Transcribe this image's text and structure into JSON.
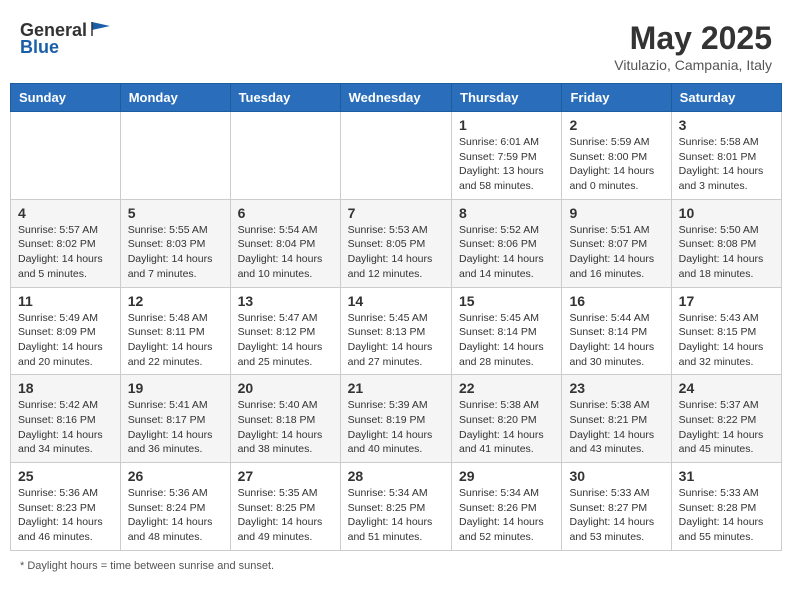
{
  "logo": {
    "text_general": "General",
    "text_blue": "Blue"
  },
  "header": {
    "month_title": "May 2025",
    "location": "Vitulazio, Campania, Italy"
  },
  "days_of_week": [
    "Sunday",
    "Monday",
    "Tuesday",
    "Wednesday",
    "Thursday",
    "Friday",
    "Saturday"
  ],
  "footer": {
    "note": "Daylight hours"
  },
  "weeks": [
    [
      {
        "day": "",
        "info": ""
      },
      {
        "day": "",
        "info": ""
      },
      {
        "day": "",
        "info": ""
      },
      {
        "day": "",
        "info": ""
      },
      {
        "day": "1",
        "info": "Sunrise: 6:01 AM\nSunset: 7:59 PM\nDaylight: 13 hours\nand 58 minutes."
      },
      {
        "day": "2",
        "info": "Sunrise: 5:59 AM\nSunset: 8:00 PM\nDaylight: 14 hours\nand 0 minutes."
      },
      {
        "day": "3",
        "info": "Sunrise: 5:58 AM\nSunset: 8:01 PM\nDaylight: 14 hours\nand 3 minutes."
      }
    ],
    [
      {
        "day": "4",
        "info": "Sunrise: 5:57 AM\nSunset: 8:02 PM\nDaylight: 14 hours\nand 5 minutes."
      },
      {
        "day": "5",
        "info": "Sunrise: 5:55 AM\nSunset: 8:03 PM\nDaylight: 14 hours\nand 7 minutes."
      },
      {
        "day": "6",
        "info": "Sunrise: 5:54 AM\nSunset: 8:04 PM\nDaylight: 14 hours\nand 10 minutes."
      },
      {
        "day": "7",
        "info": "Sunrise: 5:53 AM\nSunset: 8:05 PM\nDaylight: 14 hours\nand 12 minutes."
      },
      {
        "day": "8",
        "info": "Sunrise: 5:52 AM\nSunset: 8:06 PM\nDaylight: 14 hours\nand 14 minutes."
      },
      {
        "day": "9",
        "info": "Sunrise: 5:51 AM\nSunset: 8:07 PM\nDaylight: 14 hours\nand 16 minutes."
      },
      {
        "day": "10",
        "info": "Sunrise: 5:50 AM\nSunset: 8:08 PM\nDaylight: 14 hours\nand 18 minutes."
      }
    ],
    [
      {
        "day": "11",
        "info": "Sunrise: 5:49 AM\nSunset: 8:09 PM\nDaylight: 14 hours\nand 20 minutes."
      },
      {
        "day": "12",
        "info": "Sunrise: 5:48 AM\nSunset: 8:11 PM\nDaylight: 14 hours\nand 22 minutes."
      },
      {
        "day": "13",
        "info": "Sunrise: 5:47 AM\nSunset: 8:12 PM\nDaylight: 14 hours\nand 25 minutes."
      },
      {
        "day": "14",
        "info": "Sunrise: 5:45 AM\nSunset: 8:13 PM\nDaylight: 14 hours\nand 27 minutes."
      },
      {
        "day": "15",
        "info": "Sunrise: 5:45 AM\nSunset: 8:14 PM\nDaylight: 14 hours\nand 28 minutes."
      },
      {
        "day": "16",
        "info": "Sunrise: 5:44 AM\nSunset: 8:14 PM\nDaylight: 14 hours\nand 30 minutes."
      },
      {
        "day": "17",
        "info": "Sunrise: 5:43 AM\nSunset: 8:15 PM\nDaylight: 14 hours\nand 32 minutes."
      }
    ],
    [
      {
        "day": "18",
        "info": "Sunrise: 5:42 AM\nSunset: 8:16 PM\nDaylight: 14 hours\nand 34 minutes."
      },
      {
        "day": "19",
        "info": "Sunrise: 5:41 AM\nSunset: 8:17 PM\nDaylight: 14 hours\nand 36 minutes."
      },
      {
        "day": "20",
        "info": "Sunrise: 5:40 AM\nSunset: 8:18 PM\nDaylight: 14 hours\nand 38 minutes."
      },
      {
        "day": "21",
        "info": "Sunrise: 5:39 AM\nSunset: 8:19 PM\nDaylight: 14 hours\nand 40 minutes."
      },
      {
        "day": "22",
        "info": "Sunrise: 5:38 AM\nSunset: 8:20 PM\nDaylight: 14 hours\nand 41 minutes."
      },
      {
        "day": "23",
        "info": "Sunrise: 5:38 AM\nSunset: 8:21 PM\nDaylight: 14 hours\nand 43 minutes."
      },
      {
        "day": "24",
        "info": "Sunrise: 5:37 AM\nSunset: 8:22 PM\nDaylight: 14 hours\nand 45 minutes."
      }
    ],
    [
      {
        "day": "25",
        "info": "Sunrise: 5:36 AM\nSunset: 8:23 PM\nDaylight: 14 hours\nand 46 minutes."
      },
      {
        "day": "26",
        "info": "Sunrise: 5:36 AM\nSunset: 8:24 PM\nDaylight: 14 hours\nand 48 minutes."
      },
      {
        "day": "27",
        "info": "Sunrise: 5:35 AM\nSunset: 8:25 PM\nDaylight: 14 hours\nand 49 minutes."
      },
      {
        "day": "28",
        "info": "Sunrise: 5:34 AM\nSunset: 8:25 PM\nDaylight: 14 hours\nand 51 minutes."
      },
      {
        "day": "29",
        "info": "Sunrise: 5:34 AM\nSunset: 8:26 PM\nDaylight: 14 hours\nand 52 minutes."
      },
      {
        "day": "30",
        "info": "Sunrise: 5:33 AM\nSunset: 8:27 PM\nDaylight: 14 hours\nand 53 minutes."
      },
      {
        "day": "31",
        "info": "Sunrise: 5:33 AM\nSunset: 8:28 PM\nDaylight: 14 hours\nand 55 minutes."
      }
    ]
  ]
}
